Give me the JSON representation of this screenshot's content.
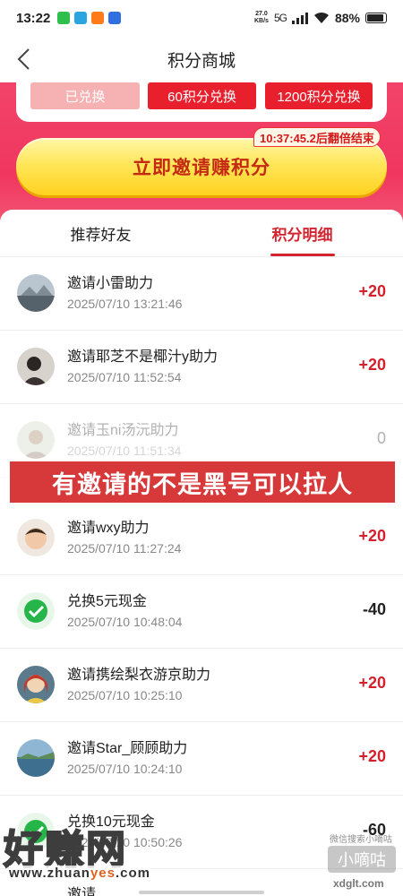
{
  "status_bar": {
    "time": "13:22",
    "net_speed_top": "27.0",
    "net_speed_unit": "KB/s",
    "network": "5G",
    "battery": "88%",
    "app_colors": [
      "#2fbf4c",
      "#2aa5e0",
      "#ff7a1a",
      "#2f6fe0"
    ]
  },
  "nav": {
    "title": "积分商城"
  },
  "exchange_buttons": {
    "done": "已兑换",
    "b60": "60积分兑换",
    "b1200": "1200积分兑换"
  },
  "invite": {
    "label": "立即邀请赚积分",
    "countdown": "10:37:45.2后翻倍结束"
  },
  "tabs": [
    "推荐好友",
    "积分明细"
  ],
  "records": [
    {
      "title": "邀请小雷助力",
      "date": "2025/07/10 13:21:46",
      "points": "+20",
      "avatar": "landscape"
    },
    {
      "title": "邀请耶芝不是椰汁y助力",
      "date": "2025/07/10 11:52:54",
      "points": "+20",
      "avatar": "person"
    },
    {
      "title": "邀请玉ni汤沅助力",
      "date": "2025/07/10 11:51:34",
      "points": "0",
      "avatar": "person-faded"
    },
    {
      "title": "邀请wxy助力",
      "date": "2025/07/10 11:27:24",
      "points": "+20",
      "avatar": "child"
    },
    {
      "title": "兑换5元现金",
      "date": "2025/07/10 10:48:04",
      "points": "-40",
      "avatar": "wechat"
    },
    {
      "title": "邀请携绘梨衣游京助力",
      "date": "2025/07/10 10:25:10",
      "points": "+20",
      "avatar": "anime"
    },
    {
      "title": "邀请Star_顾顾助力",
      "date": "2025/07/10 10:24:10",
      "points": "+20",
      "avatar": "landscape"
    },
    {
      "title": "兑换10元现金",
      "date": "2025/07/10 10:50:26",
      "points": "-60",
      "avatar": "wechat"
    },
    {
      "title": "邀请",
      "date": "",
      "points": "",
      "avatar": "person"
    }
  ],
  "overlay_banner": "有邀请的不是黑号可以拉人",
  "watermarks": {
    "left_big": "好赚网",
    "left_url_a": "www.zhuan",
    "left_url_b": "yes",
    "left_url_c": ".com",
    "right_small": "微信搜索小嘀咕",
    "right_chip": "小嘀咕",
    "right_url": "xdglt.com"
  },
  "colors": {
    "accent_red": "#d3252f",
    "band": "#f0365e",
    "invite_yellow": "#ffd21f"
  }
}
